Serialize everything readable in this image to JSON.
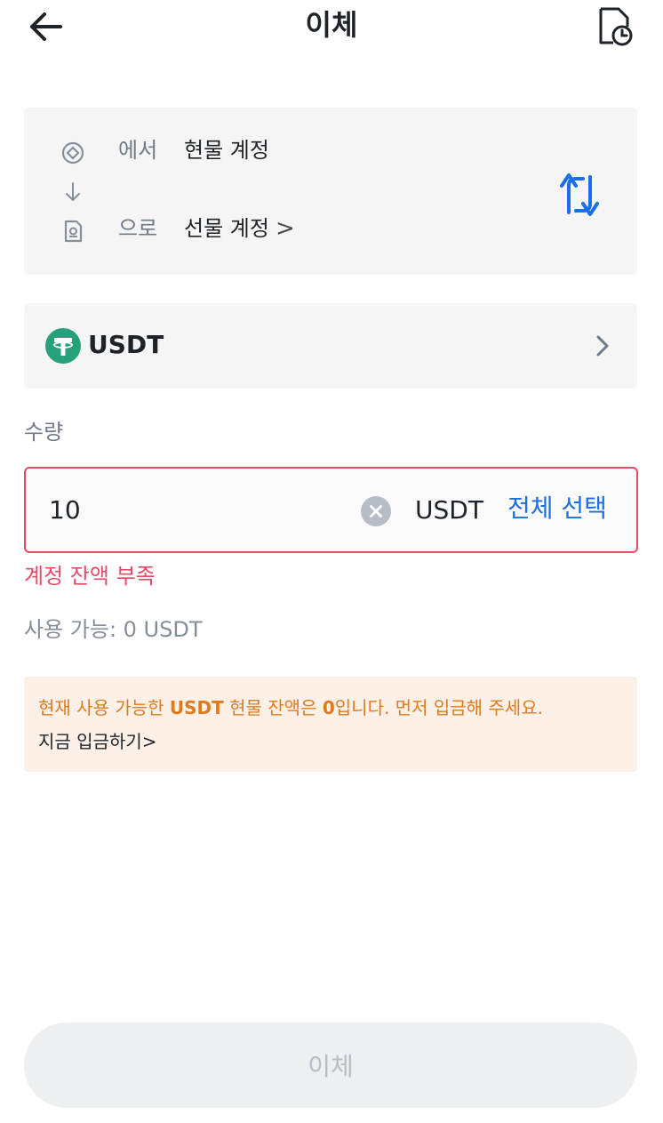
{
  "header": {
    "title": "이체",
    "back_icon": "arrow-left-icon",
    "history_icon": "document-clock-icon"
  },
  "accounts": {
    "from_label": "에서",
    "from_value": "현물 계정",
    "to_label": "으로",
    "to_value": "선물 계정",
    "to_chevron": ">",
    "swap_icon": "swap-arrows-icon"
  },
  "coin": {
    "name": "USDT",
    "icon": "tether-icon"
  },
  "amount": {
    "label": "수량",
    "value": "10",
    "unit": "USDT",
    "select_all": "전체 선택",
    "error": "계정 잔액 부족",
    "available": "사용 가능: 0 USDT"
  },
  "notice": {
    "text_prefix": "현재 사용 가능한 ",
    "text_coin": "USDT",
    "text_middle": " 현물 잔액은 ",
    "text_amount": "0",
    "text_suffix": "입니다. 먼저 입금해 주세요.",
    "link": "지금 입금하기>"
  },
  "submit": {
    "label": "이체"
  },
  "colors": {
    "accent": "#1a6ee8",
    "error": "#e84a67",
    "warning": "#e07a1f",
    "tether": "#26a17b"
  }
}
